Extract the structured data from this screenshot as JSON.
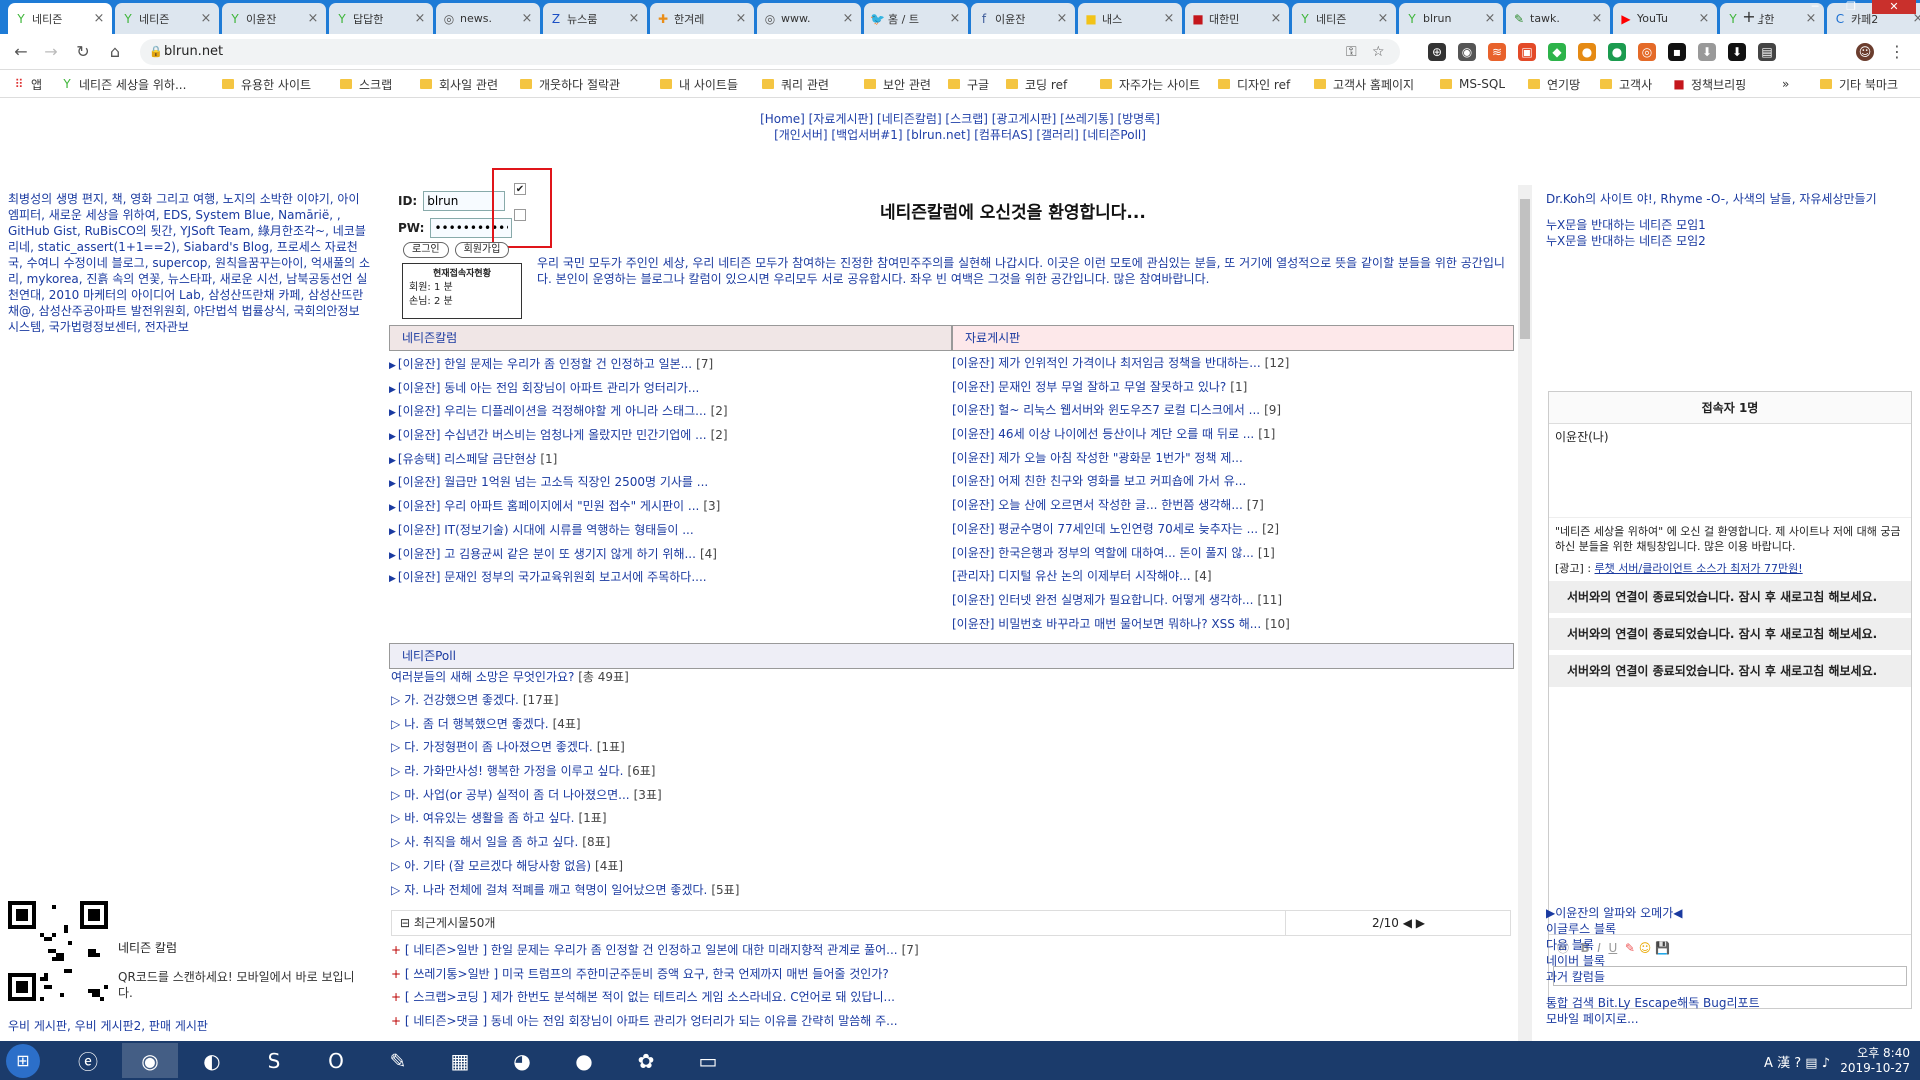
{
  "browser": {
    "tabs": [
      {
        "title": "네티즌",
        "icon": "Y",
        "color": "#3db538",
        "active": true
      },
      {
        "title": "네티즌",
        "icon": "Y",
        "color": "#3db538"
      },
      {
        "title": "이윤잔",
        "icon": "Y",
        "color": "#3db538"
      },
      {
        "title": "답답한",
        "icon": "Y",
        "color": "#3db538"
      },
      {
        "title": "news.",
        "icon": "◎",
        "color": "#555"
      },
      {
        "title": "뉴스룸",
        "icon": "Z",
        "color": "#1b4fc4"
      },
      {
        "title": "한겨레",
        "icon": "✚",
        "color": "#e98e1a"
      },
      {
        "title": "www.",
        "icon": "◎",
        "color": "#555"
      },
      {
        "title": "홈 / 트",
        "icon": "🐦",
        "color": "#1da1f2"
      },
      {
        "title": "이윤잔",
        "icon": "f",
        "color": "#3b5998"
      },
      {
        "title": "내스",
        "icon": "■",
        "color": "#f2c318"
      },
      {
        "title": "대한민",
        "icon": "■",
        "color": "#c4161c"
      },
      {
        "title": "네티즌",
        "icon": "Y",
        "color": "#3db538"
      },
      {
        "title": "blrun",
        "icon": "Y",
        "color": "#3db538"
      },
      {
        "title": "tawk.",
        "icon": "✎",
        "color": "#2c8a2c"
      },
      {
        "title": "YouTu",
        "icon": "▶",
        "color": "#ff0000"
      },
      {
        "title": "답답한",
        "icon": "Y",
        "color": "#3db538"
      },
      {
        "title": "카페2",
        "icon": "C",
        "color": "#1b6fd1"
      }
    ],
    "url": "blrun.net",
    "bookmarks": [
      {
        "label": "앱",
        "type": "apps"
      },
      {
        "label": "네티즌 세상을 위하...",
        "type": "site"
      },
      {
        "label": "유용한 사이트",
        "type": "folder"
      },
      {
        "label": "스크랩",
        "type": "folder"
      },
      {
        "label": "회사일 관련",
        "type": "folder"
      },
      {
        "label": "개웃하다 절락관",
        "type": "folder"
      },
      {
        "label": "내 사이트들",
        "type": "folder"
      },
      {
        "label": "쿼리 관련",
        "type": "folder"
      },
      {
        "label": "보안 관련",
        "type": "folder"
      },
      {
        "label": "구글",
        "type": "folder"
      },
      {
        "label": "코딩 ref",
        "type": "folder"
      },
      {
        "label": "자주가는 사이트",
        "type": "folder"
      },
      {
        "label": "디자인 ref",
        "type": "folder"
      },
      {
        "label": "고객사 홈페이지",
        "type": "folder"
      },
      {
        "label": "MS-SQL",
        "type": "folder"
      },
      {
        "label": "연기땅",
        "type": "folder"
      },
      {
        "label": "고객사",
        "type": "folder"
      },
      {
        "label": "정책브리핑",
        "type": "site"
      },
      {
        "label": "»",
        "type": "more"
      },
      {
        "label": "기타 북마크",
        "type": "folder"
      }
    ]
  },
  "page": {
    "topnav_line1": "[Home] [자료게시판] [네티즌칼럼] [스크랩] [광고게시판] [쓰레기통] [방명록]",
    "topnav_line2": "[개인서버] [백업서버#1] [blrun.net] [컴퓨터AS] [갤러리] [네티즌Poll]",
    "left_blurb": "최병성의 생명 편지, 책, 영화 그리고 여행, 노지의 소박한 이야기, 아이엠피터, 새로운 세상을 위하여, EDS, System Blue, Namārië, , GitHub Gist, RuBisCO의 됫간, YJSoft Team, 綠月한조각~, 네코블리네, static_assert(1+1==2), Siabard's Blog, 프로세스 자료천국, 수여니 수정이네 블로그, supercop, 원칙을꿈꾸는아이, 억새풀의 소리, mykorea, 진흙 속의 연꽃, 뉴스타파, 새로운 시선, 남북공동선언 실천연대, 2010 마케터의 아이디어 Lab, 삼성산뜨란채 카페, 삼성산뜨란채@, 삼성산주공아파트 발전위원회, 야단법석 법률상식, 국회의안정보시스템, 국가법령정보센터, 전자관보",
    "login": {
      "id_label": "ID:",
      "id_value": "blrun",
      "pw_label": "PW:",
      "pw_value": "************",
      "login_btn": "로그인",
      "join_btn": "회원가입",
      "visitors_title": "현재접속자현황",
      "members_line": "회원:   1 분",
      "guests_line": "손님:   2 분"
    },
    "welcome": "네티즌칼럼에 오신것을 환영합니다...",
    "intro": "우리 국민 모두가 주인인 세상, 우리 네티즌 모두가 참여하는 진정한 참여민주주의를 실현해 나갑시다. 이곳은 이런 모토에 관심있는 분들, 또 거기에 열성적으로 뜻을 같이할 분들을 위한 공간입니다. 본인이 운영하는 블로그나 칼럼이 있으시면 우리모두 서로 공유합시다. 좌우 빈 여백은 그것을 위한 공간입니다. 많은 참여바랍니다.",
    "column_board": {
      "title": "네티즌칼럼",
      "posts": [
        {
          "text": "[이윤잔] 한일 문제는 우리가 좀 인정할 건 인정하고 일본...",
          "count": "[7]"
        },
        {
          "text": "[이윤잔] 동네 아는 전임 회장님이 아파트 관리가 엉터리가...",
          "count": ""
        },
        {
          "text": "[이윤잔] 우리는 디플레이션을 걱정해야할 게 아니라 스태그...",
          "count": "[2]"
        },
        {
          "text": "[이윤잔] 수십년간 버스비는 엄청나게 올랐지만 민간기업에 ...",
          "count": "[2]"
        },
        {
          "text": "[유송택] 리스페달 금단현상",
          "count": "[1]"
        },
        {
          "text": "[이윤잔] 월급만 1억원 넘는 고소득 직장인 2500명 기사를 ...",
          "count": ""
        },
        {
          "text": "[이윤잔] 우리 아파트 홈페이지에서 \"민원 접수\" 게시판이 ...",
          "count": "[3]"
        },
        {
          "text": "[이윤잔] IT(정보기술) 시대에 시류를 역행하는 형태들이 ...",
          "count": ""
        },
        {
          "text": "[이윤잔] 고 김용균씨 같은 분이 또 생기지 않게 하기 위해...",
          "count": "[4]"
        },
        {
          "text": "[이윤잔] 문재인 정부의 국가교육위원회 보고서에 주목하다....",
          "count": ""
        }
      ]
    },
    "data_board": {
      "title": "자료게시판",
      "posts": [
        {
          "text": "[이윤잔] 제가 인위적인 가격이나 최저임금 정책을 반대하는...",
          "count": "[12]"
        },
        {
          "text": "[이윤잔] 문재인 정부 무얼 잘하고 무얼 잘못하고 있나?",
          "count": "[1]"
        },
        {
          "text": "[이윤잔] 헐~ 리눅스 웹서버와 윈도우즈7 로컬 디스크에서 ...",
          "count": "[9]"
        },
        {
          "text": "[이윤잔] 46세 이상 나이에선 등산이나 계단 오를 때 뒤로 ...",
          "count": "[1]"
        },
        {
          "text": "[이윤잔] 제가 오늘 아침 작성한 \"광화문 1번가\" 정책 제...",
          "count": ""
        },
        {
          "text": "[이윤잔] 어제 친한 친구와 영화를 보고 커피숍에 가서 유...",
          "count": ""
        },
        {
          "text": "[이윤잔] 오늘 산에 오르면서 작성한 글... 한번쯤 생각해...",
          "count": "[7]"
        },
        {
          "text": "[이윤잔] 평균수명이 77세인데 노인연령 70세로 늦추자는 ...",
          "count": "[2]"
        },
        {
          "text": "[이윤잔] 한국은행과 정부의 역할에 대하여... 돈이 풀지 않...",
          "count": "[1]"
        },
        {
          "text": "[관리자] 디지털 유산 논의 이제부터 시작해야...",
          "count": "[4]"
        },
        {
          "text": "[이윤잔] 인터넷 완전 실명제가 필요합니다. 어떻게 생각하...",
          "count": "[11]"
        },
        {
          "text": "[이윤잔] 비밀번호 바꾸라고 매번 물어보면 뭐하나? XSS 해...",
          "count": "[10]"
        }
      ]
    },
    "poll": {
      "title": "네티즌Poll",
      "question": "여러분들의 새해 소망은 무엇인가요?",
      "total": "[총 49표]",
      "options": [
        {
          "text": "가. 건강했으면 좋겠다.",
          "votes": "[17표]"
        },
        {
          "text": "나. 좀 더 행복했으면 좋겠다.",
          "votes": "[4표]"
        },
        {
          "text": "다. 가정형편이 좀 나아졌으면 좋겠다.",
          "votes": "[1표]"
        },
        {
          "text": "라. 가화만사성! 행복한 가정을 이루고 싶다.",
          "votes": "[6표]"
        },
        {
          "text": "마. 사업(or 공부) 실적이 좀 더 나아졌으면...",
          "votes": "[3표]"
        },
        {
          "text": "바. 여유있는 생활을 좀 하고 싶다.",
          "votes": "[1표]"
        },
        {
          "text": "사. 취직을 해서 일을 좀 하고 싶다.",
          "votes": "[8표]"
        },
        {
          "text": "아. 기타 (잘 모르겠다 해당사항 없음)",
          "votes": "[4표]"
        },
        {
          "text": "자. 나라 전체에 걸쳐 적폐를 깨고 혁명이 일어났으면 좋겠다.",
          "votes": "[5표]"
        }
      ]
    },
    "recent": {
      "title": "최근게시물50개",
      "page": "2/10",
      "posts": [
        {
          "text": "[ 네티즌>일반 ] 한일 문제는 우리가 좀 인정할 건 인정하고 일본에 대한 미래지향적 관계로 풀어...",
          "count": "[7]"
        },
        {
          "text": "[ 쓰레기통>일반 ] 미국 트럼프의 주한미군주둔비 증액 요구, 한국 언제까지 매번 들어줄 것인가?",
          "count": ""
        },
        {
          "text": "[ 스크랩>코딩 ] 제가 한번도 분석해본 적이 없는 테트리스 게임 소스라네요. C언어로 돼 있답니...",
          "count": ""
        },
        {
          "text": "[ 네티즌>댓글 ] 동네 아는 전임 회장님이 아파트 관리가 엉터리가 되는 이유를 간략히 말씀해 주...",
          "count": ""
        }
      ]
    },
    "qr": {
      "title": "네티즌 칼럼",
      "desc": "QR코드를 스캔하세요! 모바일에서 바로 보입니다."
    },
    "left_links": "우비 게시판, 우비 게시판2, 판매 게시판",
    "right_top": {
      "line1": "Dr.Koh의 사이트 야!, Rhyme -O-, 사색의 날들, 자유세상만들기",
      "line2": "누X문을 반대하는 네티즌 모임1",
      "line3": "누X문을 반대하는 네티즌 모임2"
    },
    "chat": {
      "title": "접속자 1명",
      "user": "이윤잔(나)",
      "welcome": "\"네티즌 세상을 위하여\" 에 오신 걸 환영합니다. 제 사이트나 저에 대해 궁금하신 분들을 위한 채팅창입니다. 많은 이용 바랍니다.",
      "ad_label": "[광고] :",
      "ad_link": "루챗 서버/클라이언트 소스가 최저가 77만원!",
      "error": "서버와의 연결이 종료되었습니다. 잠시 후 새로고침 해보세요."
    },
    "right_bottom": {
      "line1": "▶이윤잔의 알파와 오메가◀",
      "line2": "이글루스 블록",
      "line3": "다음 블록",
      "line4": "네이버 블록",
      "line5": "과거 칼럼들",
      "line6": "통합 검색 Bit.Ly Escape해독 Bug리포트",
      "line7": "모바일 페이지로..."
    }
  },
  "taskbar": {
    "time": "오후 8:40",
    "date": "2019-10-27",
    "ime": "A 漢"
  }
}
